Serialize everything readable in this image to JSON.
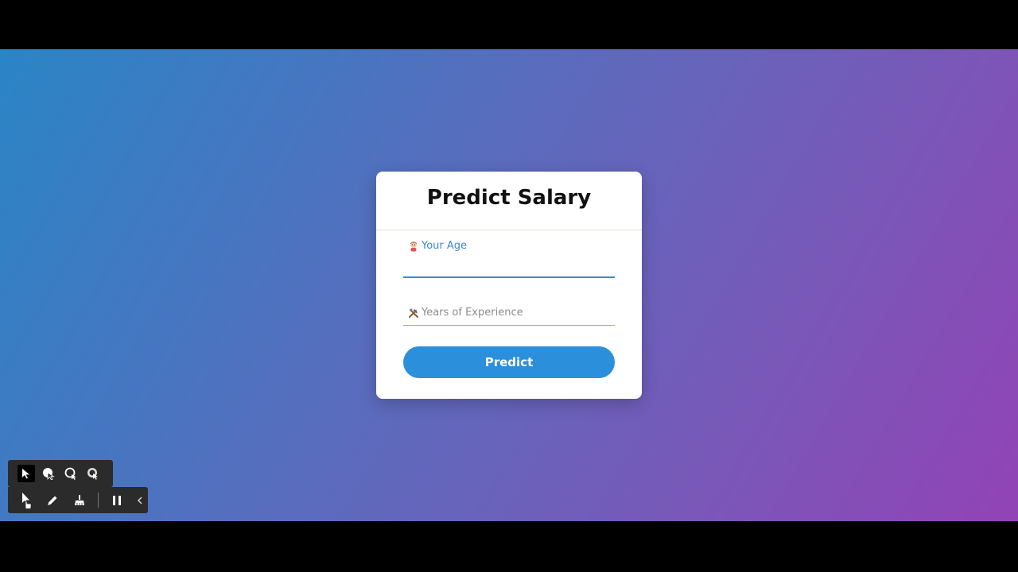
{
  "card": {
    "title": "Predict Salary"
  },
  "form": {
    "age": {
      "label": "Your Age",
      "icon": "baby-emoji-icon",
      "value": ""
    },
    "experience": {
      "label": "Years of Experience",
      "icon": "tools-emoji-icon",
      "value": ""
    },
    "submit_label": "Predict"
  },
  "toolbar": {
    "top_tools": [
      "pointer-icon",
      "spotlight-icon",
      "loop-icon",
      "highlight-cursor-icon"
    ],
    "bottom_tools": [
      "cursor-icon",
      "pen-icon",
      "eraser-icon",
      "pause-icon",
      "collapse-chevron-icon"
    ]
  },
  "colors": {
    "gradient_start": "#2a85c6",
    "gradient_end": "#9243b6",
    "accent": "#2b8fdc",
    "active_label": "#3a8ad0"
  }
}
